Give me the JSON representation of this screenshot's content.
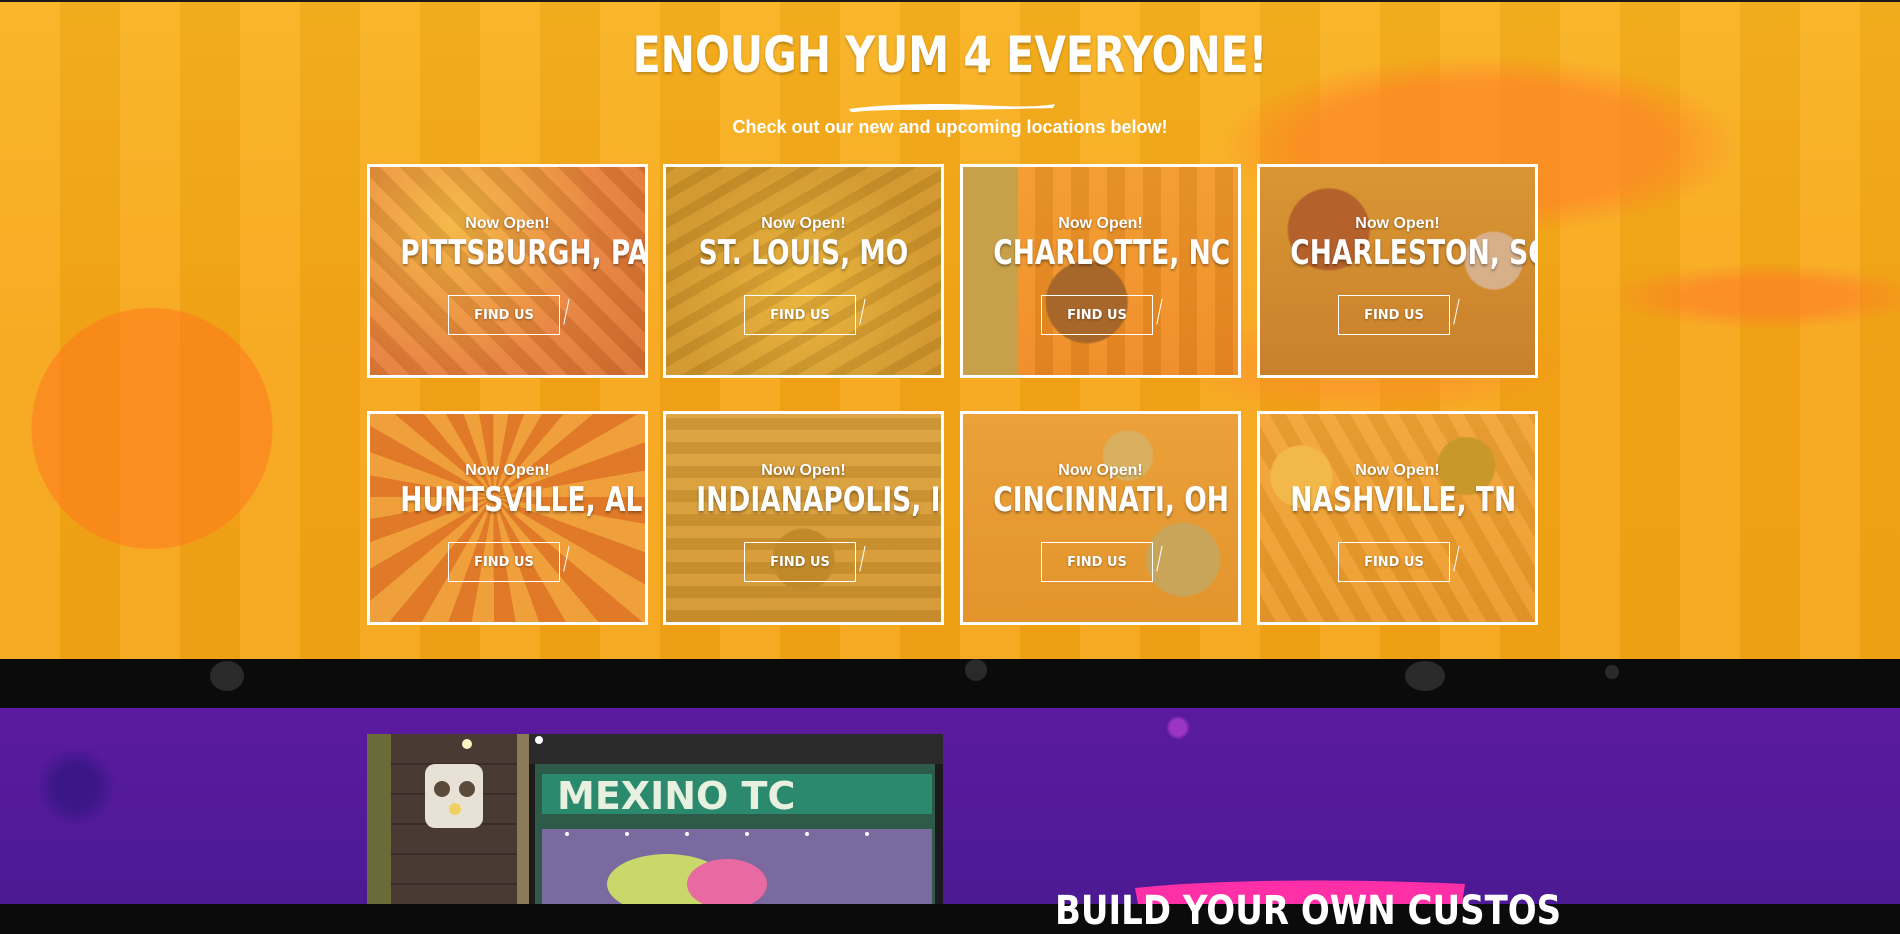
{
  "hero": {
    "title": "ENOUGH YUM 4 EVERYONE!",
    "subtitle": "Check out our new and upcoming locations below!"
  },
  "locations": [
    {
      "status": "Now Open!",
      "city": "PITTSBURGH, PA",
      "button": "FIND US",
      "tint": "#e8803a"
    },
    {
      "status": "Now Open!",
      "city": "ST. LOUIS, MO",
      "button": "FIND US",
      "tint": "#d99a2e"
    },
    {
      "status": "Now Open!",
      "city": "CHARLOTTE, NC",
      "button": "FIND US",
      "tint": "#ef8a22"
    },
    {
      "status": "Now Open!",
      "city": "CHARLESTON, SC",
      "button": "FIND US",
      "tint": "#c9802c"
    },
    {
      "status": "Now Open!",
      "city": "HUNTSVILLE, AL",
      "button": "FIND US",
      "tint": "#e98b2a"
    },
    {
      "status": "Now Open!",
      "city": "INDIANAPOLIS, IN",
      "button": "FIND US",
      "tint": "#d4962e"
    },
    {
      "status": "Now Open!",
      "city": "CINCINNATI, OH",
      "button": "FIND US",
      "tint": "#e3952c"
    },
    {
      "status": "Now Open!",
      "city": "NASHVILLE, TN",
      "button": "FIND US",
      "tint": "#ec9a2a"
    }
  ],
  "next_section": {
    "heading": "BUILD YOUR OWN CUSTOS"
  },
  "colors": {
    "hero_bg": "#f7a516",
    "purple_bg": "#4c1a93",
    "accent_pink": "#ff2fa8"
  }
}
